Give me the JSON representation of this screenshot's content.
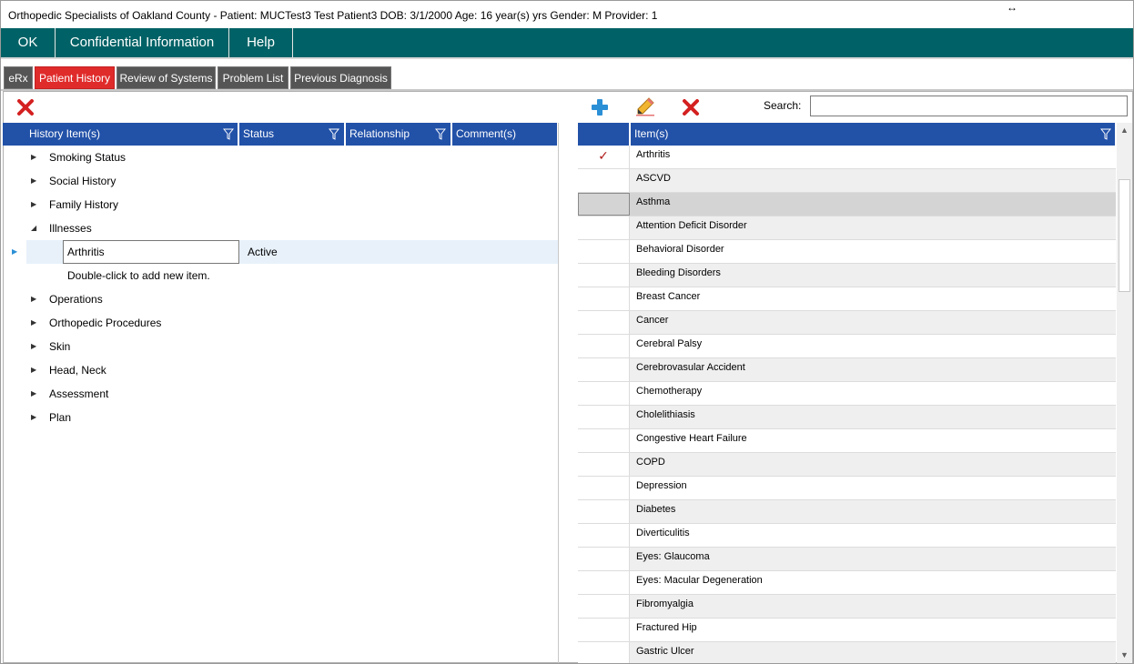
{
  "window": {
    "title": "Orthopedic Specialists of Oakland County - Patient: MUCTest3 Test  Patient3 DOB: 3/1/2000 Age: 16 year(s) yrs Gender: M Provider: 1",
    "resize_glyph": "↔"
  },
  "menu": {
    "items": [
      {
        "label": "OK"
      },
      {
        "label": "Confidential Information"
      },
      {
        "label": "Help"
      }
    ]
  },
  "tabs": [
    {
      "label": "eRx",
      "active": false
    },
    {
      "label": "Patient History",
      "active": true
    },
    {
      "label": "Review of Systems",
      "active": false
    },
    {
      "label": "Problem List",
      "active": false
    },
    {
      "label": "Previous Diagnosis",
      "active": false
    }
  ],
  "left_grid": {
    "columns": [
      "History Item(s)",
      "Status",
      "Relationship",
      "Comment(s)"
    ],
    "tree": [
      {
        "label": "Smoking Status",
        "expanded": false
      },
      {
        "label": "Social History",
        "expanded": false
      },
      {
        "label": "Family History",
        "expanded": false
      },
      {
        "label": "Illnesses",
        "expanded": true
      },
      {
        "label": "Operations",
        "expanded": false
      },
      {
        "label": "Orthopedic Procedures",
        "expanded": false
      },
      {
        "label": "Skin",
        "expanded": false
      },
      {
        "label": "Head, Neck",
        "expanded": false
      },
      {
        "label": "Assessment",
        "expanded": false
      },
      {
        "label": "Plan",
        "expanded": false
      }
    ],
    "selected_item": {
      "name": "Arthritis",
      "status": "Active"
    },
    "add_hint": "Double-click to add new item."
  },
  "right_grid": {
    "search_label": "Search:",
    "search_value": "",
    "column": "Item(s)",
    "items": [
      {
        "name": "Arthritis",
        "checked": true
      },
      {
        "name": "ASCVD",
        "checked": false
      },
      {
        "name": "Asthma",
        "checked": false,
        "highlighted": true
      },
      {
        "name": "Attention Deficit Disorder",
        "checked": false
      },
      {
        "name": "Behavioral Disorder",
        "checked": false
      },
      {
        "name": "Bleeding Disorders",
        "checked": false
      },
      {
        "name": "Breast Cancer",
        "checked": false
      },
      {
        "name": "Cancer",
        "checked": false
      },
      {
        "name": "Cerebral Palsy",
        "checked": false
      },
      {
        "name": "Cerebrovasular Accident",
        "checked": false
      },
      {
        "name": "Chemotherapy",
        "checked": false
      },
      {
        "name": "Cholelithiasis",
        "checked": false
      },
      {
        "name": "Congestive Heart Failure",
        "checked": false
      },
      {
        "name": "COPD",
        "checked": false
      },
      {
        "name": "Depression",
        "checked": false
      },
      {
        "name": "Diabetes",
        "checked": false
      },
      {
        "name": "Diverticulitis",
        "checked": false
      },
      {
        "name": "Eyes: Glaucoma",
        "checked": false
      },
      {
        "name": "Eyes: Macular Degeneration",
        "checked": false
      },
      {
        "name": "Fibromyalgia",
        "checked": false
      },
      {
        "name": "Fractured Hip",
        "checked": false
      },
      {
        "name": "Gastric Ulcer",
        "checked": false
      }
    ]
  },
  "icons": {
    "delete": "close-x-icon",
    "add": "plus-icon",
    "edit": "pencil-icon",
    "filter": "filter-icon",
    "check": "checkmark-icon"
  },
  "colors": {
    "menu_bar": "#006266",
    "active_tab": "#e02b2b",
    "inactive_tab": "#555555",
    "grid_header": "#2251a8",
    "delete_red": "#d42020",
    "add_blue": "#2b8fd6",
    "checkmark": "#b01818"
  }
}
